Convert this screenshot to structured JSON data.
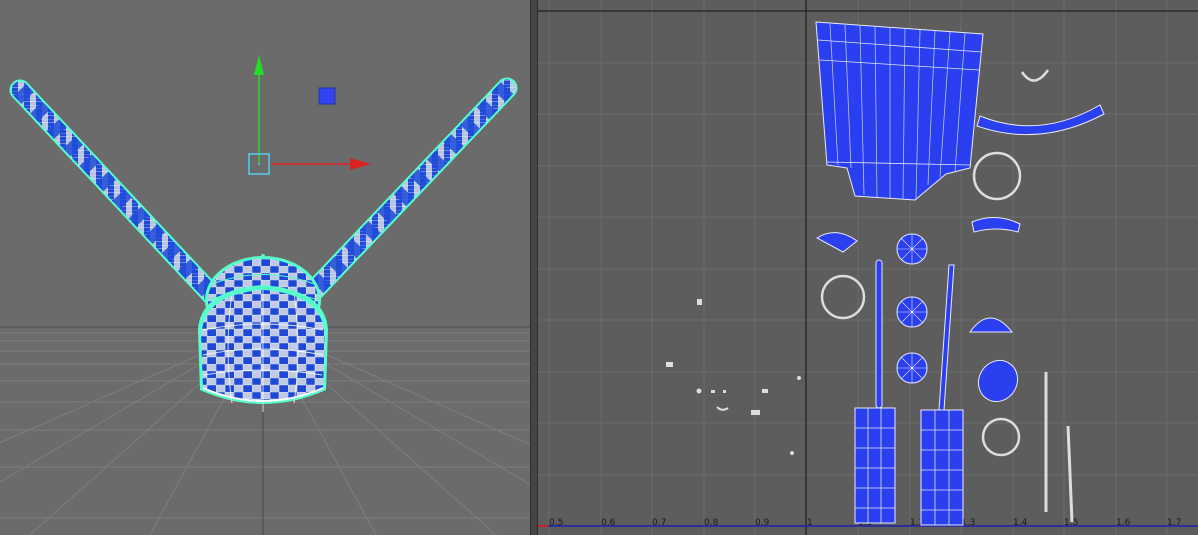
{
  "viewport": {
    "panel": "3d-perspective-viewport",
    "object": "uv-mapped-mesh",
    "manipulator": "move-tool",
    "colors": {
      "background": "#6b6b6b",
      "grid": "#7d7d7d",
      "selection_wire": "#55ffcc",
      "checker_dark": "#1f4bd8",
      "checker_light": "#b8c4e6",
      "axis_y": "#22dd22",
      "axis_x": "#dd2222",
      "axis_z": "#3344ee"
    }
  },
  "uv_editor": {
    "panel": "uv-texture-editor",
    "u_ticks": [
      "0.5",
      "0.6",
      "0.7",
      "0.8",
      "0.9",
      "1",
      "1.1",
      "1.2",
      "1.3",
      "1.4",
      "1.5",
      "1.6",
      "1.7"
    ],
    "colors": {
      "background": "#5d5d5d",
      "grid": "#6a6a6a",
      "shell_fill": "#2a3ff0",
      "shell_edge": "#e8e8ff",
      "axis_u": "#1a22aa",
      "axis_v": "#000000"
    }
  }
}
